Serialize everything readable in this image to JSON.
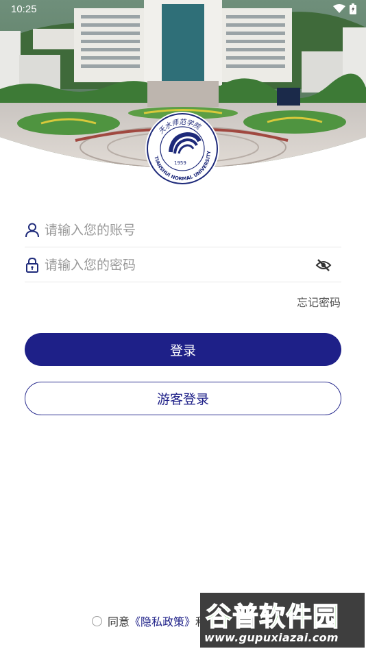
{
  "status_bar": {
    "time": "10:25"
  },
  "logo": {
    "year": "1959",
    "arc_text": "TIANSHUI NORMAL UNIVERSITY",
    "calligraphy": "天水师范学院"
  },
  "login_form": {
    "account_placeholder": "请输入您的账号",
    "password_placeholder": "请输入您的密码",
    "forgot_label": "忘记密码",
    "login_label": "登录",
    "guest_label": "游客登录"
  },
  "agreement": {
    "prefix": "同意",
    "privacy_link": "《隐私政策》",
    "connector": "和"
  },
  "watermark": {
    "brand_green": "谷",
    "brand_gray": "普",
    "brand_rest": "软件园",
    "url": "www.gupuxiazai.com"
  },
  "colors": {
    "primary": "#1e2088",
    "border": "#2a2d8f"
  }
}
